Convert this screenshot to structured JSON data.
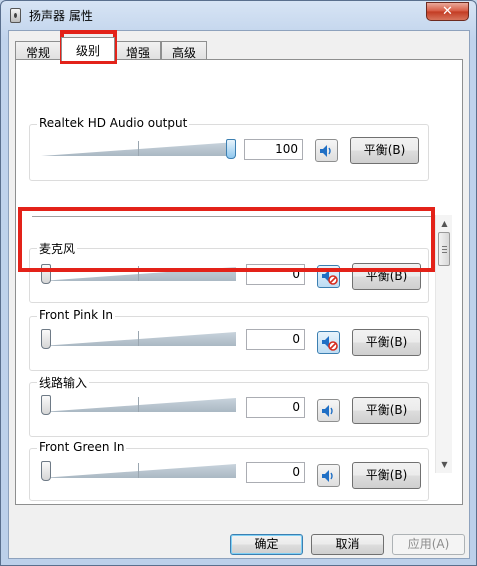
{
  "window": {
    "title": "扬声器 属性",
    "close_glyph": "✕"
  },
  "tabs": [
    {
      "label": "常规"
    },
    {
      "label": "级别"
    },
    {
      "label": "增强"
    },
    {
      "label": "高级"
    }
  ],
  "active_tab": "级别",
  "channels": [
    {
      "name": "Realtek HD Audio output",
      "value": "100",
      "level": 1.0,
      "muted": false,
      "balance_label": "平衡(B)"
    },
    {
      "name": "麦克风",
      "value": "0",
      "level": 0.0,
      "muted": true,
      "balance_label": "平衡(B)"
    },
    {
      "name": "Front Pink In",
      "value": "0",
      "level": 0.0,
      "muted": true,
      "balance_label": "平衡(B)"
    },
    {
      "name": "线路输入",
      "value": "0",
      "level": 0.0,
      "muted": false,
      "balance_label": "平衡(B)"
    },
    {
      "name": "Front Green In",
      "value": "0",
      "level": 0.0,
      "muted": false,
      "balance_label": "平衡(B)"
    }
  ],
  "buttons": {
    "ok": "确定",
    "cancel": "取消",
    "apply": "应用(A)"
  },
  "icons": {
    "title": "speaker-device-icon",
    "close": "close-icon",
    "speaker": "speaker-icon",
    "speaker_muted": "speaker-muted-icon"
  },
  "colors": {
    "highlight": "#e32219",
    "mute_accent": "#d62d20",
    "speaker_blue": "#1f6fc5"
  }
}
